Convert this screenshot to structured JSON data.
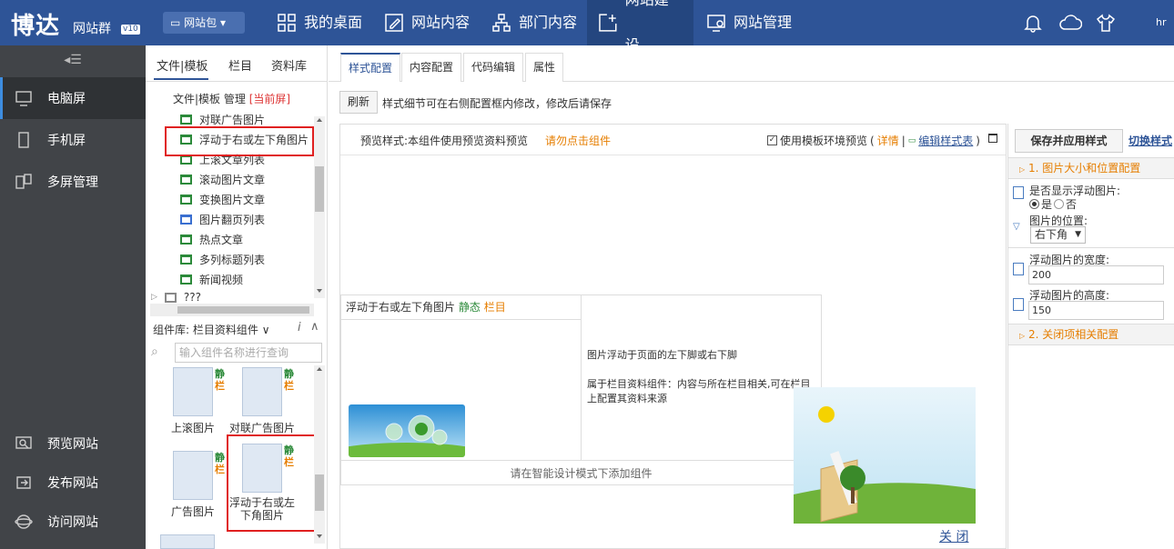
{
  "header": {
    "logo_text": "博达",
    "logo_sub": "网站群",
    "version": "v10",
    "site_package": "网站包",
    "nav": [
      {
        "label": "我的桌面",
        "icon": "grid-icon"
      },
      {
        "label": "网站内容",
        "icon": "edit-icon"
      },
      {
        "label": "部门内容",
        "icon": "org-icon"
      },
      {
        "label": "网站建设",
        "icon": "build-icon"
      },
      {
        "label": "网站管理",
        "icon": "monitor-gear-icon"
      }
    ],
    "user": "hr"
  },
  "sidebar": {
    "top": [
      {
        "label": "电脑屏",
        "icon": "desktop-icon"
      },
      {
        "label": "手机屏",
        "icon": "mobile-icon"
      },
      {
        "label": "多屏管理",
        "icon": "multiscreen-icon"
      }
    ],
    "bottom": [
      {
        "label": "预览网站",
        "icon": "preview-icon"
      },
      {
        "label": "发布网站",
        "icon": "publish-icon"
      },
      {
        "label": "访问网站",
        "icon": "globe-icon"
      }
    ]
  },
  "tree": {
    "tabs": [
      "文件|模板",
      "栏目",
      "资料库"
    ],
    "header_prefix": "文件|模板 管理",
    "header_current": "[当前屏]",
    "items": [
      "对联广告图片",
      "浮动于右或左下角图片",
      "上滚文章列表",
      "滚动图片文章",
      "变换图片文章",
      "图片翻页列表",
      "热点文章",
      "多列标题列表",
      "新闻视频",
      "???"
    ]
  },
  "library": {
    "header": "组件库: 栏目资料组件",
    "search_placeholder": "输入组件名称进行查询",
    "tag_static": "静",
    "tag_column": "栏",
    "items": [
      "上滚图片",
      "对联广告图片",
      "广告图片",
      "浮动于右或左下角图片"
    ]
  },
  "main": {
    "tabs": [
      "样式配置",
      "内容配置",
      "代码编辑",
      "属性"
    ],
    "refresh": "刷新",
    "refresh_note": "样式细节可在右侧配置框内修改，修改后请保存",
    "preview_label": "预览样式:本组件使用预览资料预览",
    "preview_warning": "请勿点击组件",
    "use_template": "使用模板环境预览",
    "detail_link": "详情",
    "edit_style_link": "编辑样式表",
    "card": {
      "title": "浮动于右或左下角图片",
      "tag_static": "静态",
      "tag_column": "栏目",
      "desc1": "图片浮动于页面的左下脚或右下脚",
      "desc2": "属于栏目资料组件：内容与所在栏目相关,可在栏目上配置其资料来源",
      "footer": "请在智能设计模式下添加组件"
    },
    "close": "关 闭"
  },
  "config": {
    "save": "保存并应用样式",
    "switch": "切换样式",
    "section1": "1. 图片大小和位置配置",
    "show_float": "是否显示浮动图片:",
    "yes": "是",
    "no": "否",
    "position_label": "图片的位置:",
    "position_value": "右下角",
    "width_label": "浮动图片的宽度:",
    "width_value": "200",
    "height_label": "浮动图片的高度:",
    "height_value": "150",
    "section2": "2. 关闭项相关配置"
  },
  "colors": {
    "header": "#2e5497",
    "sidebar": "#414448",
    "accent": "#e67e00",
    "highlight": "#e02020"
  }
}
